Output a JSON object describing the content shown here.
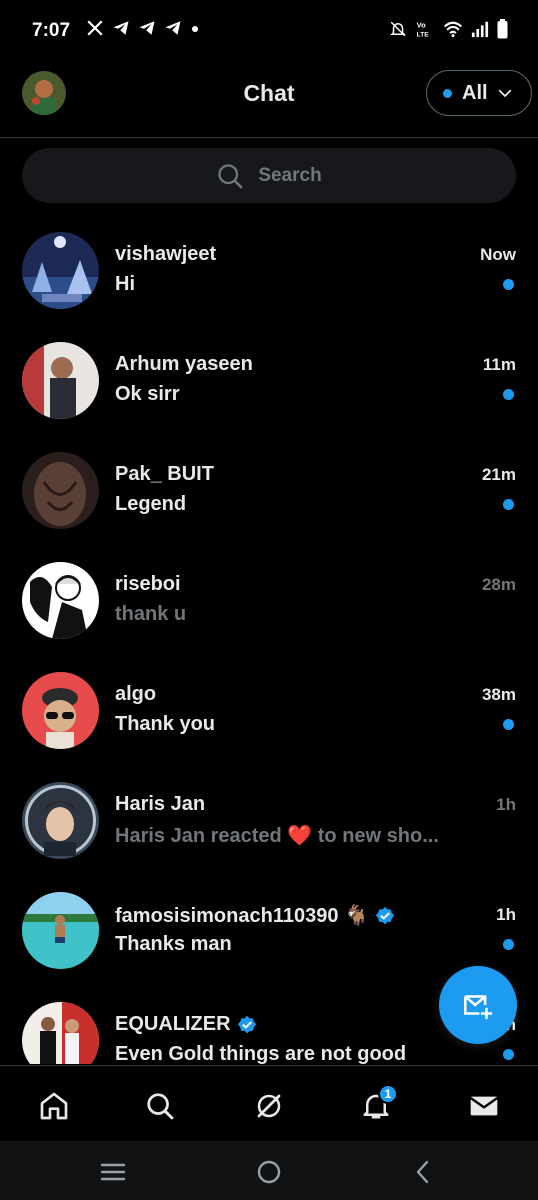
{
  "status_bar": {
    "time": "7:07",
    "left_icons": [
      "x-logo-icon",
      "telegram-icon",
      "telegram-icon",
      "telegram-icon",
      "dot-icon"
    ],
    "right_icons": [
      "mute-icon",
      "volte-icon",
      "wifi-icon",
      "signal-icon",
      "battery-icon"
    ]
  },
  "header": {
    "title": "Chat",
    "filter": {
      "label": "All",
      "dot_color": "#1d9bf0"
    }
  },
  "search": {
    "placeholder": "Search"
  },
  "conversations": [
    {
      "name": "vishawjeet",
      "message": "Hi",
      "time": "Now",
      "unread": true,
      "verified": false
    },
    {
      "name": "Arhum yaseen",
      "message": "Ok sirr",
      "time": "11m",
      "unread": true,
      "verified": false
    },
    {
      "name": "Pak_ BUIT",
      "message": "Legend",
      "time": "21m",
      "unread": true,
      "verified": false
    },
    {
      "name": "riseboi",
      "message": "thank u",
      "time": "28m",
      "unread": false,
      "verified": false
    },
    {
      "name": "algo",
      "message": "Thank you",
      "time": "38m",
      "unread": true,
      "verified": false
    },
    {
      "name": "Haris Jan",
      "message": "Haris Jan reacted ❤️ to new sho...",
      "time": "1h",
      "unread": false,
      "verified": false
    },
    {
      "name": "famosisimonach110390 🐐",
      "message": "Thanks man",
      "time": "1h",
      "unread": true,
      "verified": true
    },
    {
      "name": "EQUALIZER",
      "message": "Even Gold things are not good",
      "time": "1h",
      "unread": true,
      "verified": true
    }
  ],
  "bottom_nav": {
    "items": [
      "home-icon",
      "search-icon",
      "grok-icon",
      "notifications-icon",
      "messages-icon"
    ],
    "notifications_badge": "1"
  },
  "system_nav": [
    "recents-icon",
    "home-circle-icon",
    "back-icon"
  ],
  "colors": {
    "accent": "#1d9bf0",
    "background": "#000000",
    "muted": "#71767b"
  }
}
